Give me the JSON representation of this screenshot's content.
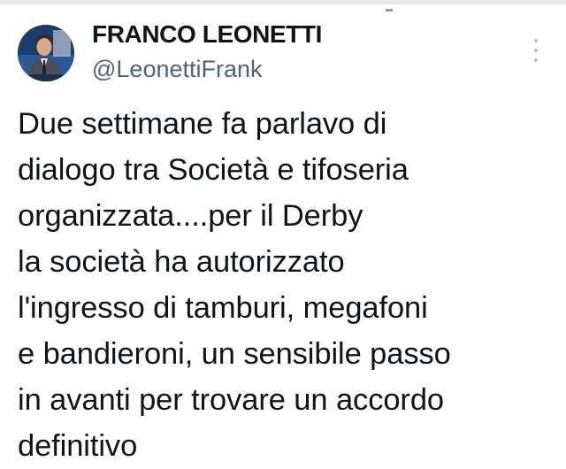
{
  "author": {
    "display_name": "FRANCO LEONETTI",
    "handle": "@LeonettiFrank",
    "avatar_icon": "profile-photo"
  },
  "menu": {
    "icon": "more-vertical-icon"
  },
  "tweet": {
    "lines": [
      "Due settimane fa parlavo di",
      "dialogo tra Società e tifoseria",
      "organizzata....per il Derby",
      "la società ha autorizzato",
      "l'ingresso di tamburi, megafoni",
      "e bandieroni, un sensibile passo",
      "in avanti per trovare un accordo",
      "definitivo"
    ]
  },
  "colors": {
    "text": "#0f1419",
    "secondary_text": "#536471",
    "background": "#ffffff"
  }
}
